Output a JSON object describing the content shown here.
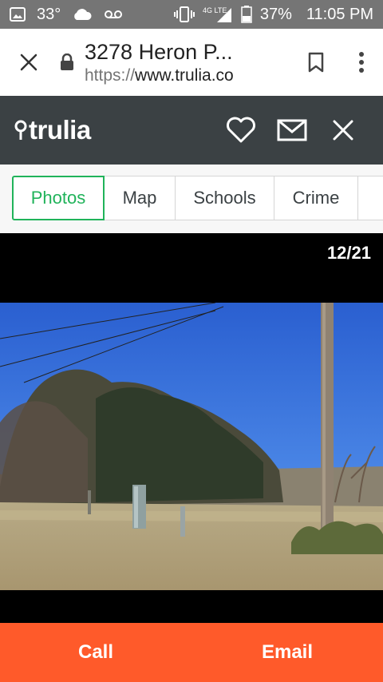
{
  "status_bar": {
    "temperature": "33°",
    "battery_percent": "37%",
    "time": "11:05 PM",
    "network": "4G LTE",
    "icons": [
      "image-icon",
      "cloud-icon",
      "voicemail-icon",
      "vibrate-icon",
      "signal-icon",
      "battery-icon"
    ]
  },
  "browser": {
    "page_title": "3278 Heron P...",
    "url_scheme": "https://",
    "url_host": "www.trulia.co",
    "icons": [
      "close-icon",
      "lock-icon",
      "bookmark-icon",
      "more-vert-icon"
    ]
  },
  "header": {
    "logo_text": "trulia",
    "icons": [
      "location-pin-icon",
      "heart-icon",
      "mail-icon",
      "close-icon"
    ]
  },
  "tabs": {
    "items": [
      {
        "label": "Photos",
        "active": true
      },
      {
        "label": "Map",
        "active": false
      },
      {
        "label": "Schools",
        "active": false
      },
      {
        "label": "Crime",
        "active": false
      }
    ]
  },
  "gallery": {
    "counter": "12/21",
    "current": 12,
    "total": 21
  },
  "actions": {
    "call_label": "Call",
    "email_label": "Email"
  },
  "colors": {
    "status_bar": "#757575",
    "header": "#3b4144",
    "accent_green": "#20b35a",
    "action_orange": "#ff5a2a"
  }
}
